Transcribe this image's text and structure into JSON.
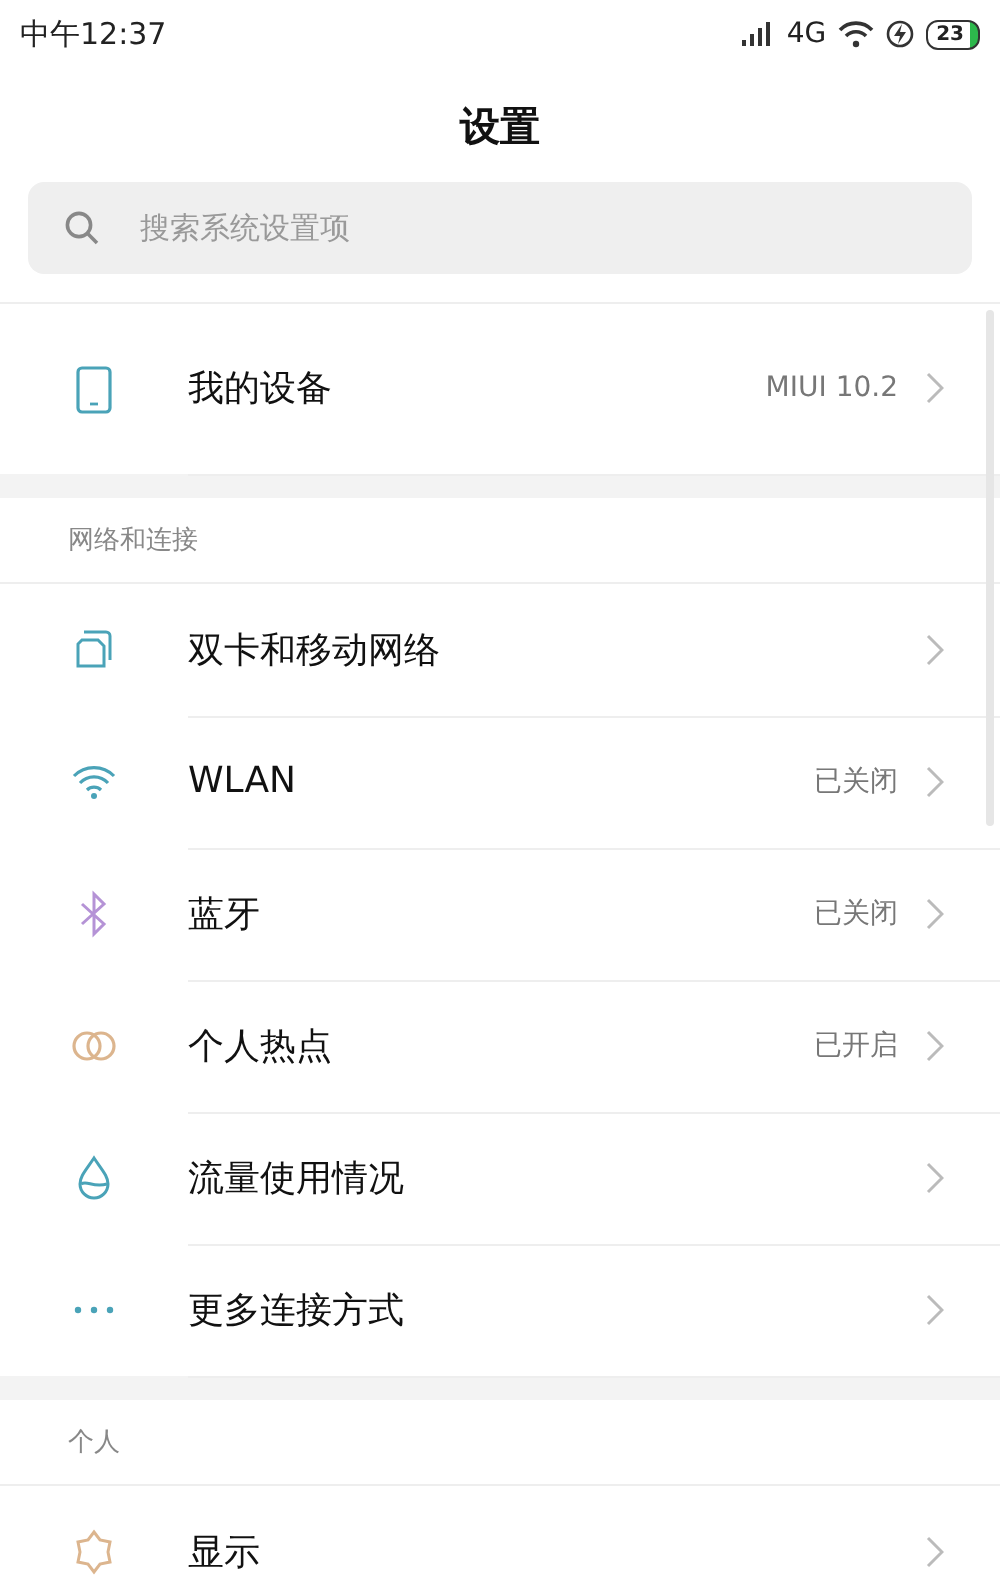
{
  "status_bar": {
    "time": "中午12:37",
    "network": "4G",
    "battery": "23"
  },
  "title": "设置",
  "search": {
    "placeholder": "搜索系统设置项"
  },
  "sections": [
    {
      "items": [
        {
          "label": "我的设备",
          "value": "MIUI 10.2"
        }
      ]
    },
    {
      "header": "网络和连接",
      "items": [
        {
          "label": "双卡和移动网络"
        },
        {
          "label": "WLAN",
          "value": "已关闭"
        },
        {
          "label": "蓝牙",
          "value": "已关闭"
        },
        {
          "label": "个人热点",
          "value": "已开启"
        },
        {
          "label": "流量使用情况"
        },
        {
          "label": "更多连接方式"
        }
      ]
    },
    {
      "header": "个人",
      "items": [
        {
          "label": "显示"
        }
      ]
    }
  ]
}
